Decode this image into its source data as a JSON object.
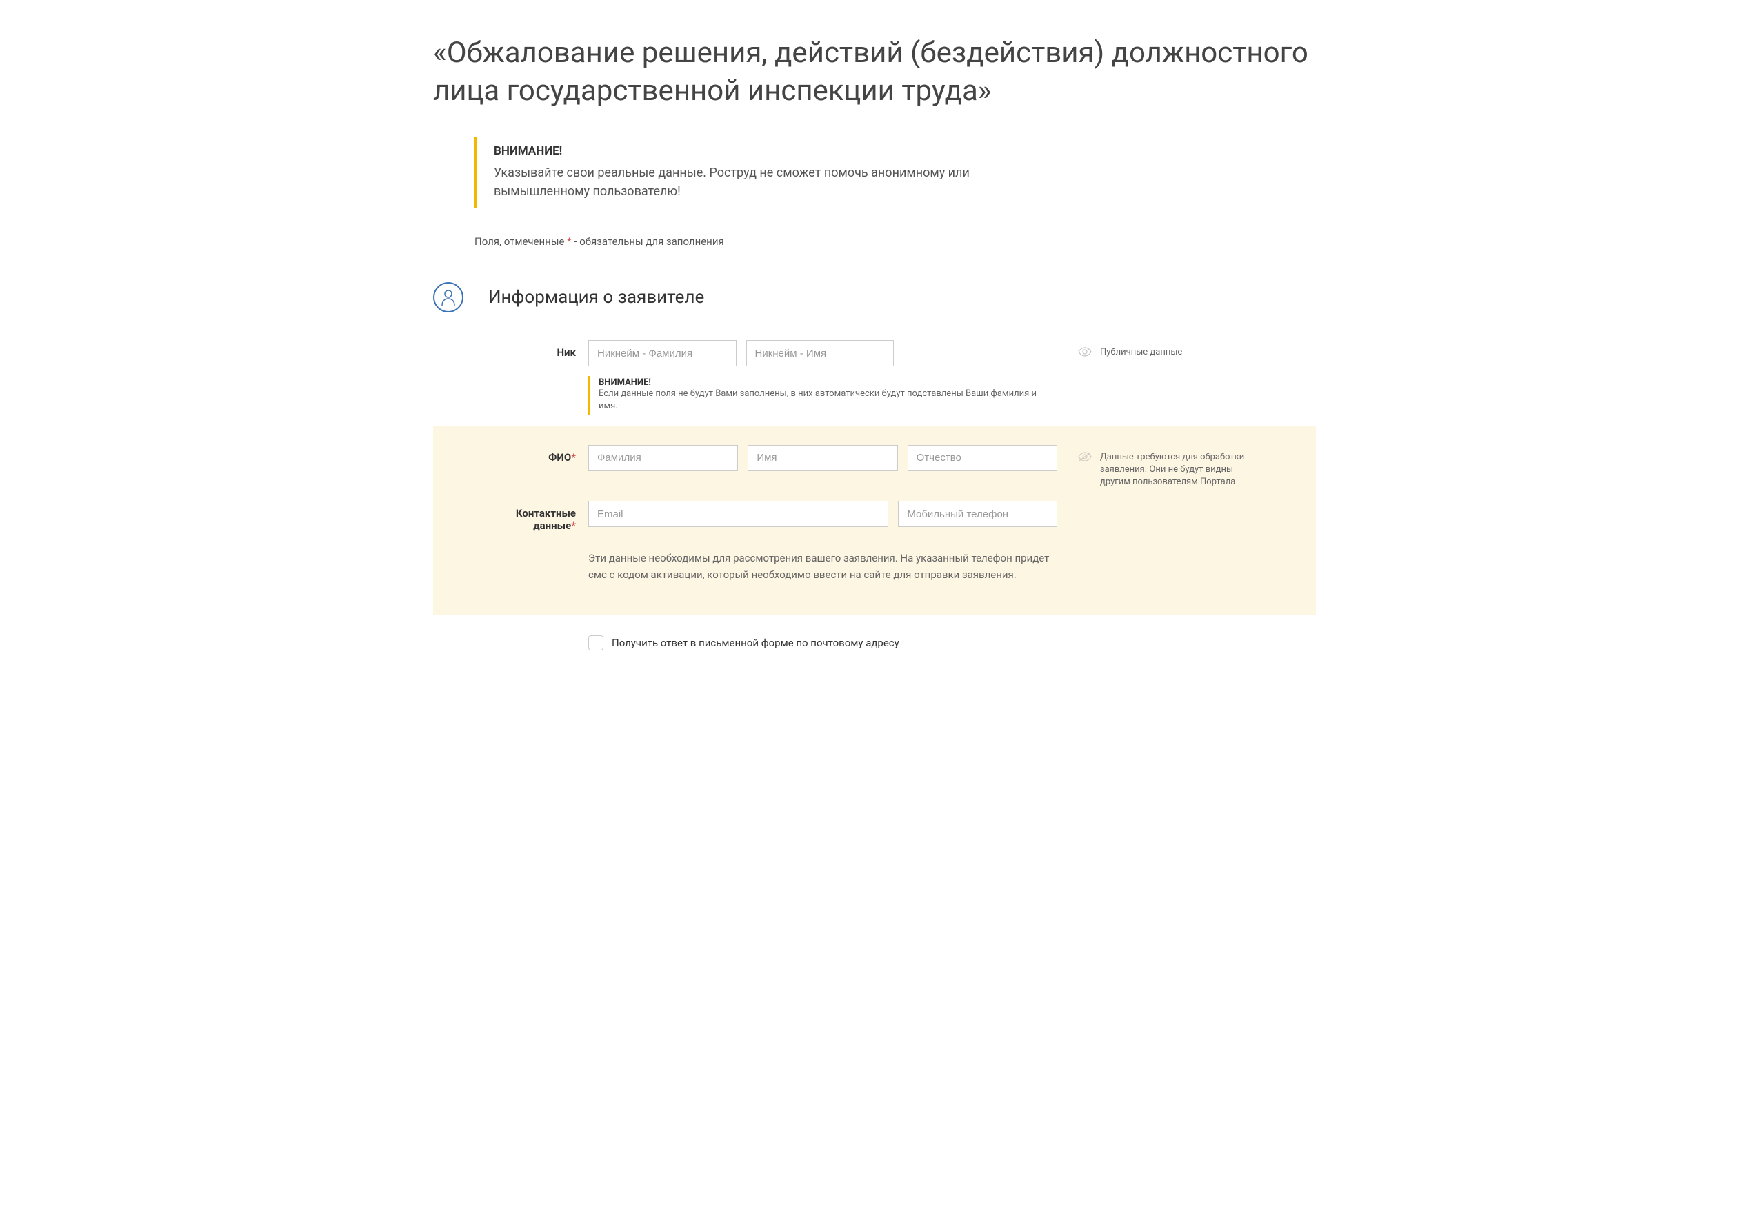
{
  "page": {
    "title": "«Обжалование решения, действий (бездействия) должностного лица государственной инспекции труда»"
  },
  "warning": {
    "title": "ВНИМАНИЕ!",
    "text": "Указывайте свои реальные данные. Роструд не сможет помочь анонимному или вымышленному пользователю!"
  },
  "requiredNote": {
    "prefix": "Поля, отмеченные ",
    "star": "*",
    "suffix": " - обязательны для заполнения"
  },
  "section": {
    "title": "Информация о заявителе"
  },
  "labels": {
    "nick": "Ник",
    "fio": "ФИО",
    "contact": "Контактные данные"
  },
  "placeholders": {
    "nickSurname": "Никнейм - Фамилия",
    "nickName": "Никнейм - Имя",
    "surname": "Фамилия",
    "firstname": "Имя",
    "patronymic": "Отчество",
    "email": "Email",
    "phone": "Мобильный телефон"
  },
  "nickWarning": {
    "title": "ВНИМАНИЕ!",
    "text": "Если данные поля не будут Вами заполнены, в них автоматически будут подставлены Ваши фамилия и имя."
  },
  "sideText": {
    "public": "Публичные данные",
    "private": "Данные требуются для обработки заявления. Они не будут видны другим пользователям Портала"
  },
  "contactHelper": "Эти данные необходимы для рассмотрения вашего заявления. На указанный телефон придет смс с кодом активации, который необходимо ввести на сайте для отправки заявления.",
  "checkbox": {
    "label": "Получить ответ в письменной форме по почтовому адресу"
  },
  "star": "*"
}
